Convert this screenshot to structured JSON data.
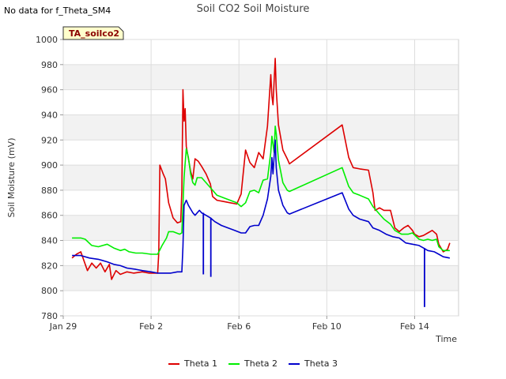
{
  "notice": "No data for f_Theta_SM4",
  "tag_label": "TA_soilco2",
  "chart_data": {
    "type": "line",
    "title": "Soil CO2 Soil Moisture",
    "xlabel": "Time",
    "ylabel": "Soil Moisture (mV)",
    "ylim": [
      780,
      1000
    ],
    "xlim": [
      0,
      18
    ],
    "yticks": [
      780,
      800,
      820,
      840,
      860,
      880,
      900,
      920,
      940,
      960,
      980,
      1000
    ],
    "xticks": [
      {
        "day": 0,
        "label": "Jan 29"
      },
      {
        "day": 4,
        "label": "Feb 2"
      },
      {
        "day": 8,
        "label": "Feb 6"
      },
      {
        "day": 12,
        "label": "Feb 10"
      },
      {
        "day": 16,
        "label": "Feb 14"
      }
    ],
    "grid": true,
    "legend_position": "bottom",
    "series": [
      {
        "name": "Theta 1",
        "color": "#dd0000",
        "points": [
          [
            0.4,
            826
          ],
          [
            0.6,
            829
          ],
          [
            0.8,
            831
          ],
          [
            0.9,
            826
          ],
          [
            1.1,
            816
          ],
          [
            1.3,
            822
          ],
          [
            1.5,
            818
          ],
          [
            1.7,
            822
          ],
          [
            1.9,
            815
          ],
          [
            2.1,
            821
          ],
          [
            2.2,
            809
          ],
          [
            2.4,
            816
          ],
          [
            2.6,
            813
          ],
          [
            2.9,
            815
          ],
          [
            3.2,
            814
          ],
          [
            3.6,
            815
          ],
          [
            3.9,
            814
          ],
          [
            4.3,
            814
          ],
          [
            4.35,
            830
          ],
          [
            4.4,
            900
          ],
          [
            4.55,
            893
          ],
          [
            4.65,
            889
          ],
          [
            4.8,
            870
          ],
          [
            5.0,
            858
          ],
          [
            5.2,
            854
          ],
          [
            5.35,
            855
          ],
          [
            5.4,
            880
          ],
          [
            5.45,
            960
          ],
          [
            5.5,
            935
          ],
          [
            5.55,
            945
          ],
          [
            5.6,
            915
          ],
          [
            5.8,
            895
          ],
          [
            5.9,
            889
          ],
          [
            6.0,
            905
          ],
          [
            6.15,
            903
          ],
          [
            6.3,
            899
          ],
          [
            6.5,
            893
          ],
          [
            6.7,
            885
          ],
          [
            6.8,
            875
          ],
          [
            7.0,
            872
          ],
          [
            7.3,
            871
          ],
          [
            7.6,
            870
          ],
          [
            7.9,
            869
          ],
          [
            8.1,
            877
          ],
          [
            8.3,
            912
          ],
          [
            8.5,
            902
          ],
          [
            8.7,
            898
          ],
          [
            8.9,
            910
          ],
          [
            9.1,
            905
          ],
          [
            9.3,
            931
          ],
          [
            9.45,
            972
          ],
          [
            9.5,
            955
          ],
          [
            9.55,
            948
          ],
          [
            9.65,
            985
          ],
          [
            9.7,
            960
          ],
          [
            9.8,
            932
          ],
          [
            10.0,
            912
          ],
          [
            10.2,
            905
          ],
          [
            10.3,
            901
          ],
          [
            12.7,
            932
          ],
          [
            13.0,
            906
          ],
          [
            13.2,
            898
          ],
          [
            13.5,
            897
          ],
          [
            13.9,
            896
          ],
          [
            14.1,
            878
          ],
          [
            14.2,
            864
          ],
          [
            14.4,
            866
          ],
          [
            14.6,
            864
          ],
          [
            14.9,
            864
          ],
          [
            15.1,
            850
          ],
          [
            15.3,
            847
          ],
          [
            15.5,
            850
          ],
          [
            15.7,
            852
          ],
          [
            15.9,
            848
          ],
          [
            16.0,
            845
          ],
          [
            16.2,
            843
          ],
          [
            16.4,
            844
          ],
          [
            16.6,
            846
          ],
          [
            16.8,
            848
          ],
          [
            17.0,
            845
          ],
          [
            17.1,
            837
          ],
          [
            17.3,
            831
          ],
          [
            17.5,
            833
          ],
          [
            17.6,
            838
          ]
        ]
      },
      {
        "name": "Theta 2",
        "color": "#00ee00",
        "points": [
          [
            0.4,
            842
          ],
          [
            0.6,
            842
          ],
          [
            0.8,
            842
          ],
          [
            1.0,
            841
          ],
          [
            1.3,
            836
          ],
          [
            1.6,
            835
          ],
          [
            1.8,
            836
          ],
          [
            2.0,
            837
          ],
          [
            2.3,
            834
          ],
          [
            2.6,
            832
          ],
          [
            2.8,
            833
          ],
          [
            3.0,
            831
          ],
          [
            3.3,
            830
          ],
          [
            3.6,
            830
          ],
          [
            4.0,
            829
          ],
          [
            4.3,
            829
          ],
          [
            4.5,
            836
          ],
          [
            4.7,
            842
          ],
          [
            4.8,
            847
          ],
          [
            5.0,
            847
          ],
          [
            5.3,
            845
          ],
          [
            5.4,
            846
          ],
          [
            5.5,
            890
          ],
          [
            5.6,
            913
          ],
          [
            5.7,
            906
          ],
          [
            5.8,
            893
          ],
          [
            5.9,
            886
          ],
          [
            6.0,
            884
          ],
          [
            6.1,
            890
          ],
          [
            6.3,
            890
          ],
          [
            6.5,
            886
          ],
          [
            6.8,
            880
          ],
          [
            7.0,
            876
          ],
          [
            7.3,
            874
          ],
          [
            7.6,
            872
          ],
          [
            7.9,
            870
          ],
          [
            8.1,
            867
          ],
          [
            8.3,
            870
          ],
          [
            8.5,
            879
          ],
          [
            8.7,
            880
          ],
          [
            8.9,
            878
          ],
          [
            9.1,
            888
          ],
          [
            9.3,
            889
          ],
          [
            9.45,
            910
          ],
          [
            9.5,
            923
          ],
          [
            9.6,
            910
          ],
          [
            9.65,
            931
          ],
          [
            9.7,
            925
          ],
          [
            9.8,
            904
          ],
          [
            10.0,
            886
          ],
          [
            10.2,
            880
          ],
          [
            10.3,
            879
          ],
          [
            12.7,
            898
          ],
          [
            13.0,
            883
          ],
          [
            13.2,
            878
          ],
          [
            13.5,
            876
          ],
          [
            13.9,
            873
          ],
          [
            14.1,
            867
          ],
          [
            14.3,
            863
          ],
          [
            14.6,
            857
          ],
          [
            14.9,
            853
          ],
          [
            15.1,
            848
          ],
          [
            15.4,
            845
          ],
          [
            15.7,
            845
          ],
          [
            15.9,
            846
          ],
          [
            16.2,
            841
          ],
          [
            16.4,
            840
          ],
          [
            16.6,
            841
          ],
          [
            16.8,
            840
          ],
          [
            17.0,
            841
          ],
          [
            17.1,
            835
          ],
          [
            17.3,
            832
          ],
          [
            17.6,
            832
          ]
        ]
      },
      {
        "name": "Theta 3",
        "color": "#0000cc",
        "points": [
          [
            0.4,
            828
          ],
          [
            0.8,
            828
          ],
          [
            1.2,
            826
          ],
          [
            1.6,
            825
          ],
          [
            2.0,
            823
          ],
          [
            2.3,
            821
          ],
          [
            2.6,
            820
          ],
          [
            2.9,
            818
          ],
          [
            3.3,
            817
          ],
          [
            3.6,
            816
          ],
          [
            4.0,
            815
          ],
          [
            4.3,
            814
          ],
          [
            4.6,
            814
          ],
          [
            4.9,
            814
          ],
          [
            5.2,
            815
          ],
          [
            5.4,
            815
          ],
          [
            5.45,
            835
          ],
          [
            5.5,
            868
          ],
          [
            5.6,
            872
          ],
          [
            5.7,
            868
          ],
          [
            5.9,
            862
          ],
          [
            6.0,
            860
          ],
          [
            6.2,
            864
          ],
          [
            6.3,
            862
          ],
          [
            6.5,
            860
          ],
          [
            6.7,
            858
          ],
          [
            6.9,
            855
          ],
          [
            7.2,
            852
          ],
          [
            7.5,
            850
          ],
          [
            7.8,
            848
          ],
          [
            8.1,
            846
          ],
          [
            8.3,
            846
          ],
          [
            8.5,
            851
          ],
          [
            8.7,
            852
          ],
          [
            8.9,
            852
          ],
          [
            9.1,
            860
          ],
          [
            9.3,
            873
          ],
          [
            9.45,
            891
          ],
          [
            9.5,
            906
          ],
          [
            9.55,
            893
          ],
          [
            9.65,
            920
          ],
          [
            9.7,
            898
          ],
          [
            9.8,
            880
          ],
          [
            10.0,
            868
          ],
          [
            10.2,
            862
          ],
          [
            10.3,
            861
          ],
          [
            12.7,
            878
          ],
          [
            13.0,
            865
          ],
          [
            13.2,
            860
          ],
          [
            13.5,
            857
          ],
          [
            13.9,
            855
          ],
          [
            14.1,
            850
          ],
          [
            14.4,
            848
          ],
          [
            14.7,
            845
          ],
          [
            15.0,
            843
          ],
          [
            15.3,
            842
          ],
          [
            15.6,
            838
          ],
          [
            15.9,
            837
          ],
          [
            16.2,
            836
          ],
          [
            16.4,
            834
          ],
          [
            16.6,
            832
          ],
          [
            16.9,
            831
          ],
          [
            17.1,
            829
          ],
          [
            17.3,
            827
          ],
          [
            17.6,
            826
          ]
        ],
        "spikes": [
          {
            "x": 6.38,
            "from": 862,
            "to": 813
          },
          {
            "x": 6.72,
            "from": 858,
            "to": 811
          },
          {
            "x": 16.45,
            "from": 834,
            "to": 787
          }
        ]
      }
    ]
  }
}
